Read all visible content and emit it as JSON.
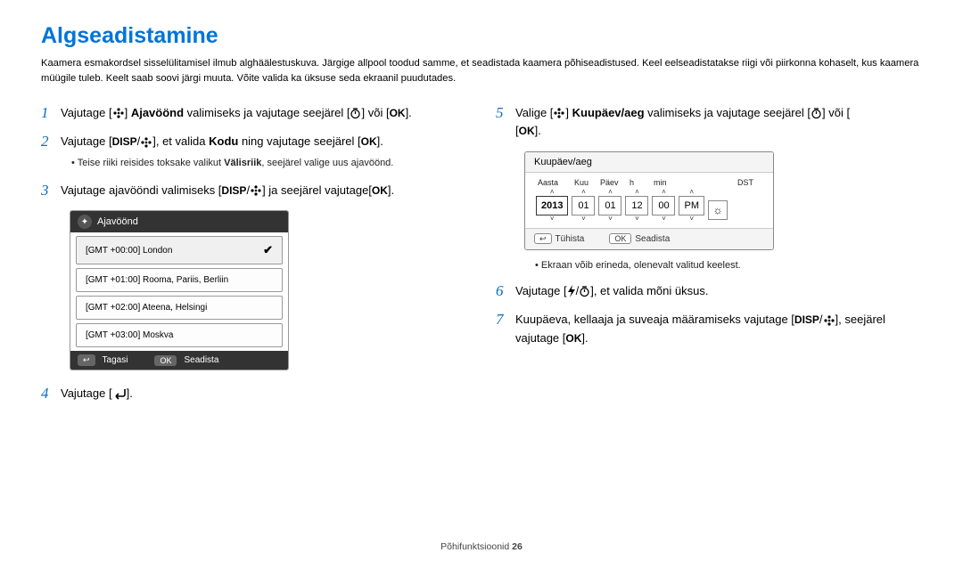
{
  "title": "Algseadistamine",
  "intro": "Kaamera esmakordsel sisselülitamisel ilmub alghäälestuskuva. Järgige allpool toodud samme, et seadistada kaamera põhiseadistused. Keel eelseadistatakse riigi või piirkonna kohaselt, kus kaamera müügile tuleb. Keelt saab soovi järgi muuta. Võite valida ka üksuse seda ekraanil puudutades.",
  "left": {
    "s1a": "Vajutage [",
    "s1b": "] ",
    "s1bold": "Ajavöönd",
    "s1c": " valimiseks ja vajutage seejärel [",
    "s1d": "] või [",
    "s1e": "].",
    "s2a": "Vajutage [",
    "s2b": "/",
    "s2c": "], et valida ",
    "s2bold": "Kodu",
    "s2d": " ning vajutage seejärel [",
    "s2e": "].",
    "s2sub_a": "Teise riiki reisides toksake valikut ",
    "s2sub_bold": "Välisriik",
    "s2sub_b": ", seejärel valige uus ajavöönd.",
    "s3a": "Vajutage ajavööndi valimiseks [",
    "s3b": "/",
    "s3c": "] ja seejärel vajutage[",
    "s3d": "].",
    "s4": "Vajutage [",
    "s4b": "]."
  },
  "right": {
    "s5a": "Valige [",
    "s5b": "] ",
    "s5bold": "Kuupäev/aeg",
    "s5c": " valimiseks ja vajutage seejärel [",
    "s5d": "] või [",
    "s5e": "].",
    "s5sub": "Ekraan võib erineda, olenevalt valitud keelest.",
    "s6a": "Vajutage [",
    "s6b": "/",
    "s6c": "], et valida mõni üksus.",
    "s7a": "Kuupäeva, kellaaja ja suveaja määramiseks vajutage [",
    "s7b": "/",
    "s7c": "], seejärel vajutage [",
    "s7d": "]."
  },
  "tz_panel": {
    "title": "Ajavöönd",
    "items": [
      "[GMT +00:00] London",
      "[GMT +01:00] Rooma, Pariis, Berliin",
      "[GMT +02:00] Ateena, Helsingi",
      "[GMT +03:00] Moskva"
    ],
    "foot_back": "Tagasi",
    "foot_ok": "OK",
    "foot_set": "Seadista"
  },
  "dt_panel": {
    "title": "Kuupäev/aeg",
    "labels": [
      "Aasta",
      "Kuu",
      "Päev",
      "h",
      "min",
      "DST"
    ],
    "values": [
      "2013",
      "01",
      "01",
      "12",
      "00",
      "PM"
    ],
    "foot_cancel": "Tühista",
    "foot_ok": "OK",
    "foot_set": "Seadista"
  },
  "footer_a": "Põhifunktsioonid  ",
  "footer_b": "26"
}
